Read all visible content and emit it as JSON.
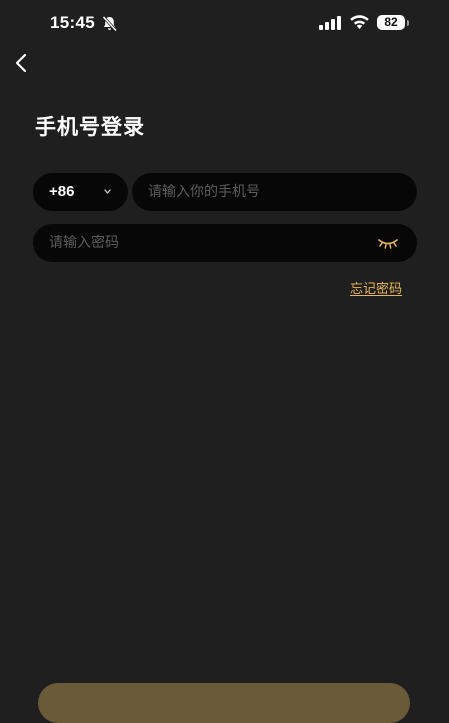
{
  "status_bar": {
    "time": "15:45",
    "battery": "82",
    "icons": [
      "bell-slash-icon",
      "signal-icon",
      "wifi-icon",
      "battery-icon"
    ]
  },
  "nav": {
    "back_icon": "chevron-left-icon"
  },
  "page": {
    "title": "手机号登录"
  },
  "form": {
    "country_code": "+86",
    "phone_placeholder": "请输入你的手机号",
    "password_placeholder": "请输入密码",
    "forgot_password": "忘记密码"
  },
  "colors": {
    "background": "#1f1f1f",
    "input_background": "#070707",
    "accent": "#e8b65a",
    "button": "#6b5a37"
  }
}
